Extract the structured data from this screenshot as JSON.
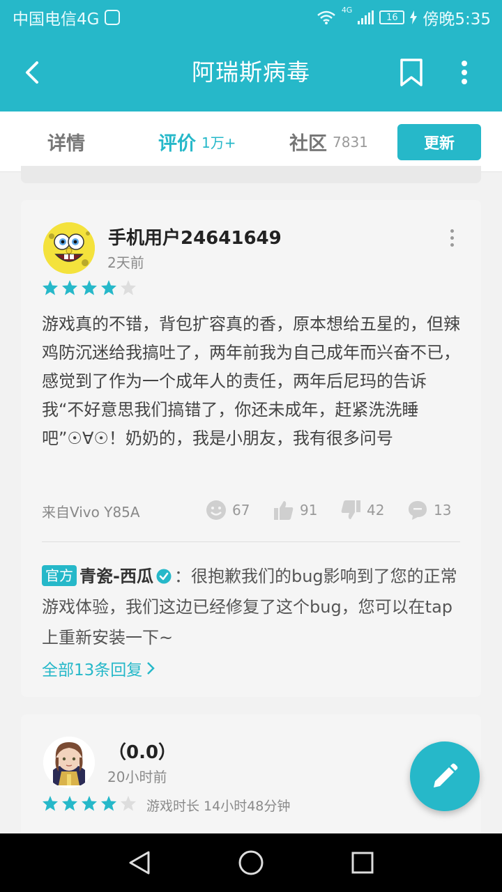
{
  "status_bar": {
    "carrier": "中国电信4G",
    "network": "4G",
    "battery": "16",
    "time": "傍晚5:35"
  },
  "app_bar": {
    "title": "阿瑞斯病毒",
    "icons": [
      "back-arrow-icon",
      "bookmark-icon",
      "more-vertical-icon"
    ]
  },
  "tabs": [
    {
      "label": "详情",
      "count": "",
      "active": false
    },
    {
      "label": "评价",
      "count": "1万+",
      "active": true
    },
    {
      "label": "社区",
      "count": "7831",
      "active": false
    }
  ],
  "update_button": "更新",
  "reviews": [
    {
      "user": "手机用户24641649",
      "time": "2天前",
      "rating": 4,
      "text": "游戏真的不错，背包扩容真的香，原本想给五星的，但辣鸡防沉迷给我搞吐了，两年前我为自己成年而兴奋不已，感觉到了作为一个成年人的责任，两年后尼玛的告诉我“不好意思我们搞错了，你还未成年，赶紧洗洗睡吧”☉∀☉！奶奶的，我是小朋友，我有很多问号",
      "device": "来自Vivo Y85A",
      "actions": {
        "funny": "67",
        "like": "91",
        "dislike": "42",
        "comments": "13"
      },
      "official_reply": {
        "badge": "官方",
        "name": "青瓷-西瓜",
        "text": "：很抱歉我们的bug影响到了您的正常游戏体验，我们这边已经修复了这个bug，您可以在tap上重新安装一下~"
      },
      "all_replies": "全部13条回复"
    },
    {
      "user": "（0.0）",
      "time": "20小时前",
      "rating": 4,
      "playtime": "游戏时长 14小时48分钟"
    }
  ],
  "colors": {
    "accent": "#26b8c9",
    "star": "#26b8c9",
    "star_empty": "#dddddd"
  }
}
